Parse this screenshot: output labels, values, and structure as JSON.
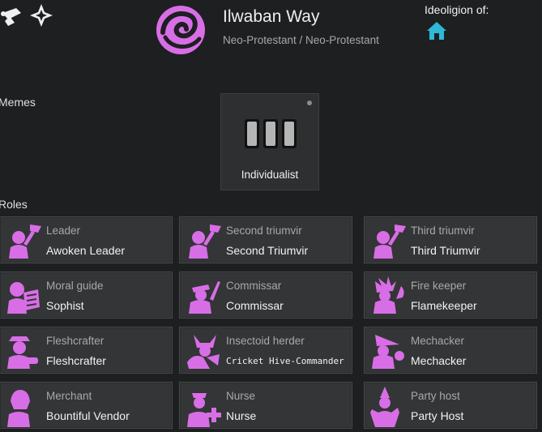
{
  "ideoligion": {
    "name": "Ilwaban Way",
    "subtitle": "Neo-Protestant / Neo-Protestant",
    "ideoligion_of_label": "Ideoligion of:",
    "icon": "swirl-eye-icon",
    "color": "#d86ee6"
  },
  "toolbar": {
    "icons": [
      "scroll-icon",
      "compass-star-icon"
    ]
  },
  "memes": {
    "label": "Memes",
    "items": [
      {
        "label": "Individualist",
        "icon": "three-bars-icon"
      }
    ]
  },
  "roles": {
    "label": "Roles",
    "items": [
      {
        "title": "Leader",
        "name": "Awoken Leader",
        "icon": "leader-icon"
      },
      {
        "title": "Second triumvir",
        "name": "Second Triumvir",
        "icon": "triumvir-icon"
      },
      {
        "title": "Third triumvir",
        "name": "Third Triumvir",
        "icon": "triumvir-icon"
      },
      {
        "title": "Moral guide",
        "name": "Sophist",
        "icon": "moral-guide-icon"
      },
      {
        "title": "Commissar",
        "name": "Commissar",
        "icon": "commissar-icon"
      },
      {
        "title": "Fire keeper",
        "name": "Flamekeeper",
        "icon": "fire-keeper-icon"
      },
      {
        "title": "Fleshcrafter",
        "name": "Fleshcrafter",
        "icon": "fleshcrafter-icon"
      },
      {
        "title": "Insectoid herder",
        "name": "Cricket Hive-Commander",
        "icon": "insectoid-herder-icon"
      },
      {
        "title": "Mechacker",
        "name": "Mechacker",
        "icon": "mechacker-icon"
      },
      {
        "title": "Merchant",
        "name": "Bountiful Vendor",
        "icon": "merchant-icon"
      },
      {
        "title": "Nurse",
        "name": "Nurse",
        "icon": "nurse-icon"
      },
      {
        "title": "Party host",
        "name": "Party Host",
        "icon": "party-host-icon"
      }
    ]
  },
  "colors": {
    "accent": "#d86ee6",
    "house": "#2fb8d8",
    "panel": "#343537"
  }
}
